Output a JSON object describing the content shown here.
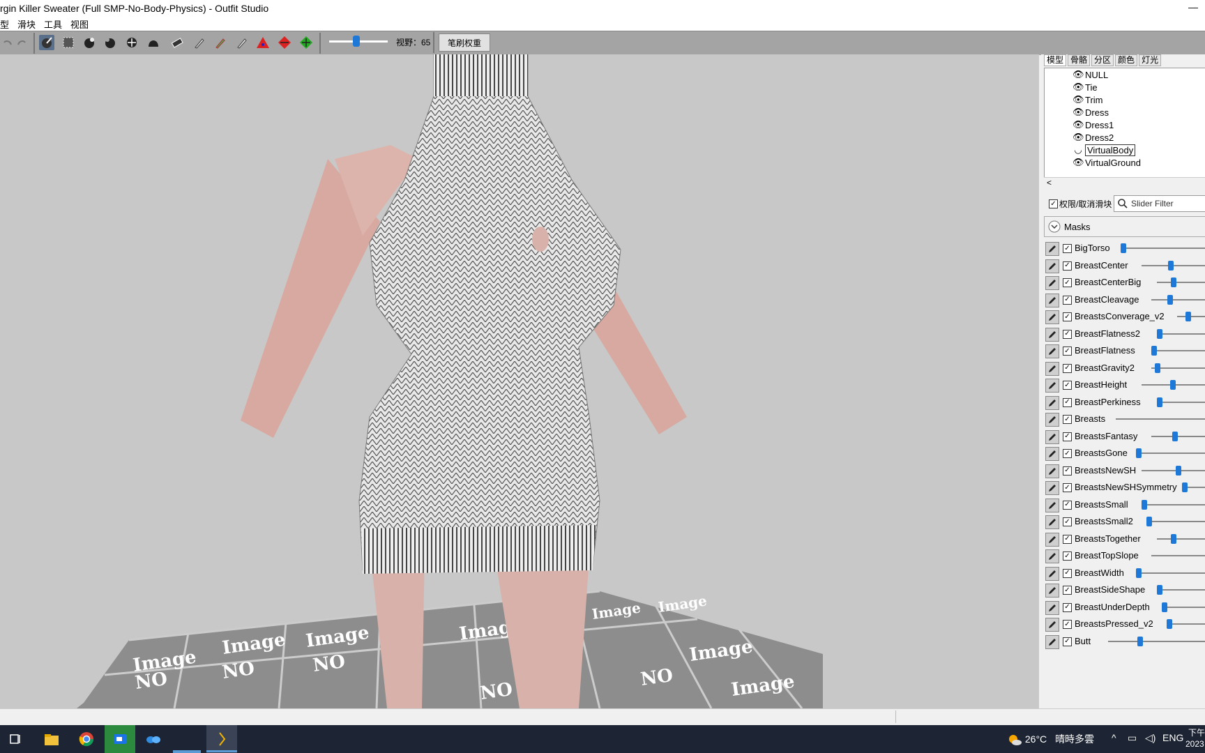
{
  "window": {
    "title": "rgin Killer Sweater (Full SMP-No-Body-Physics) - Outfit Studio",
    "minimize_glyph": "—"
  },
  "menu": [
    "型",
    "滑块",
    "工具",
    "视图"
  ],
  "toolbar": {
    "fov_label": "视野：65",
    "fov_value": 65,
    "brush_weight_button": "笔刷权重",
    "tool_icons": [
      "undo-icon",
      "redo-icon",
      "select-brush-icon",
      "mask-brush-icon",
      "inflate-brush-icon",
      "deflate-brush-icon",
      "move-brush-icon",
      "smooth-brush-icon",
      "eraser-icon",
      "weight-paint-icon",
      "color-paint-icon",
      "alpha-paint-icon",
      "transform-icon",
      "pivot-icon",
      "vertex-select-icon"
    ]
  },
  "viewport": {
    "floor_tile_text_1": "Image",
    "floor_tile_text_2": "NO"
  },
  "panel": {
    "tabs": [
      "模型",
      "骨骼",
      "分区",
      "颜色",
      "灯光"
    ],
    "active_tab": 0,
    "shapes": [
      {
        "label": "NULL",
        "selected": false
      },
      {
        "label": "Tie",
        "selected": false
      },
      {
        "label": "Trim",
        "selected": false
      },
      {
        "label": "Dress",
        "selected": false
      },
      {
        "label": "Dress1",
        "selected": false
      },
      {
        "label": "Dress2",
        "selected": false
      },
      {
        "label": "VirtualBody",
        "selected": true
      },
      {
        "label": "VirtualGround",
        "selected": false
      }
    ],
    "filter_checkbox_label": "权限/取消滑块",
    "filter_placeholder": "Slider Filter",
    "masks_label": "Masks",
    "sliders": [
      {
        "name": "BigTorso",
        "value": 0.0
      },
      {
        "name": "BreastCenter",
        "value": 0.7
      },
      {
        "name": "BreastCenterBig",
        "value": 0.5
      },
      {
        "name": "BreastCleavage",
        "value": 0.5
      },
      {
        "name": "BreastsConverage_v2",
        "value": 0.5
      },
      {
        "name": "BreastFlatness2",
        "value": 0.0
      },
      {
        "name": "BreastFlatness",
        "value": 0.0
      },
      {
        "name": "BreastGravity2",
        "value": 0.1
      },
      {
        "name": "BreastHeight",
        "value": 0.75
      },
      {
        "name": "BreastPerkiness",
        "value": 0.0
      },
      {
        "name": "Breasts",
        "value": null
      },
      {
        "name": "BreastsFantasy",
        "value": 0.65
      },
      {
        "name": "BreastsGone",
        "value": 0.0
      },
      {
        "name": "BreastsNewSH",
        "value": 0.9
      },
      {
        "name": "BreastsNewSHSymmetry",
        "value": 0.0
      },
      {
        "name": "BreastsSmall",
        "value": 0.0
      },
      {
        "name": "BreastsSmall2",
        "value": 0.0
      },
      {
        "name": "BreastsTogether",
        "value": 0.5
      },
      {
        "name": "BreastTopSlope",
        "value": null
      },
      {
        "name": "BreastWidth",
        "value": 0.0
      },
      {
        "name": "BreastSideShape",
        "value": 0.0
      },
      {
        "name": "BreastUnderDepth",
        "value": 0.0
      },
      {
        "name": "BreastsPressed_v2",
        "value": 0.0
      },
      {
        "name": "Butt",
        "value": 0.5
      }
    ]
  },
  "taskbar": {
    "weather_temp": "26°C",
    "weather_desc": "晴時多雲",
    "language": "ENG",
    "time_partial": "下午",
    "date_partial": "2023"
  },
  "colors": {
    "accent": "#1e78d7",
    "viewport_bg": "#c8c8c8",
    "toolbar_bg": "#a4a4a4",
    "taskbar_bg": "#1d2433"
  }
}
